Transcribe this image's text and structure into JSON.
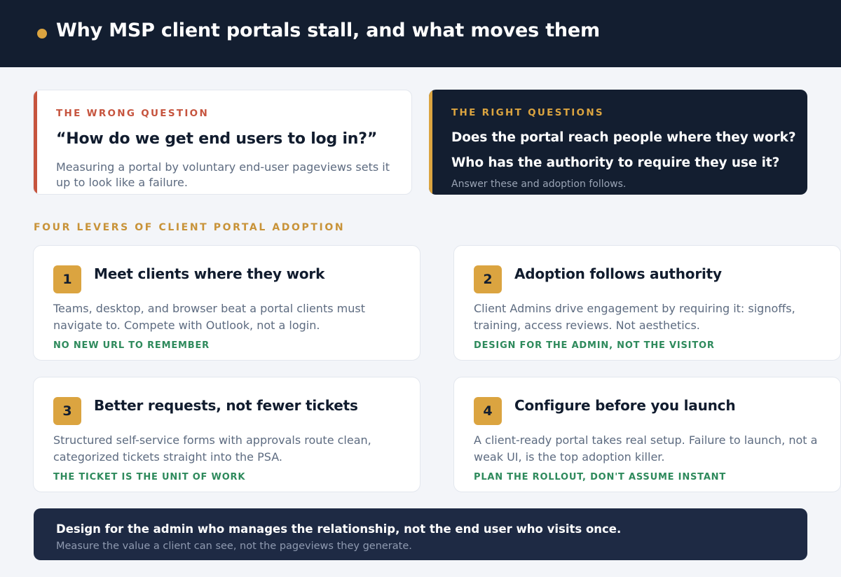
{
  "header": {
    "title": "Why MSP client portals stall, and what moves them",
    "accent": "#dba440",
    "background": "#131e30"
  },
  "wrong_question": {
    "kicker": "THE WRONG QUESTION",
    "quote": "“How do we get end users to log in?”",
    "description": "Measuring a portal by voluntary end-user pageviews sets it up to look like a failure.",
    "accent": "#c6543e"
  },
  "right_questions": {
    "kicker": "THE RIGHT QUESTIONS",
    "questions": [
      "Does the portal reach people where they work?",
      "Who has the authority to require they use it?"
    ],
    "note": "Answer these and adoption follows.",
    "accent": "#dba440"
  },
  "levers": {
    "section_title": "FOUR LEVERS OF CLIENT PORTAL ADOPTION",
    "items": [
      {
        "number": "1",
        "title": "Meet clients where they work",
        "body": "Teams, desktop, and browser beat a portal clients must navigate to. Compete with Outlook, not a login.",
        "tag": "NO NEW URL TO REMEMBER"
      },
      {
        "number": "2",
        "title": "Adoption follows authority",
        "body": "Client Admins drive engagement by requiring it: signoffs, training, access reviews. Not aesthetics.",
        "tag": "DESIGN FOR THE ADMIN, NOT THE VISITOR"
      },
      {
        "number": "3",
        "title": "Better requests, not fewer tickets",
        "body": "Structured self-service forms with approvals route clean, categorized tickets straight into the PSA.",
        "tag": "THE TICKET IS THE UNIT OF WORK"
      },
      {
        "number": "4",
        "title": "Configure before you launch",
        "body": "A client-ready portal takes real setup. Failure to launch, not a weak UI, is the top adoption killer.",
        "tag": "PLAN THE ROLLOUT, DON'T ASSUME INSTANT"
      }
    ],
    "tag_color": "#2e8a5c"
  },
  "footer": {
    "main": "Design for the admin who manages the relationship, not the end user who visits once.",
    "sub": "Measure the value a client can see, not the pageviews they generate."
  }
}
